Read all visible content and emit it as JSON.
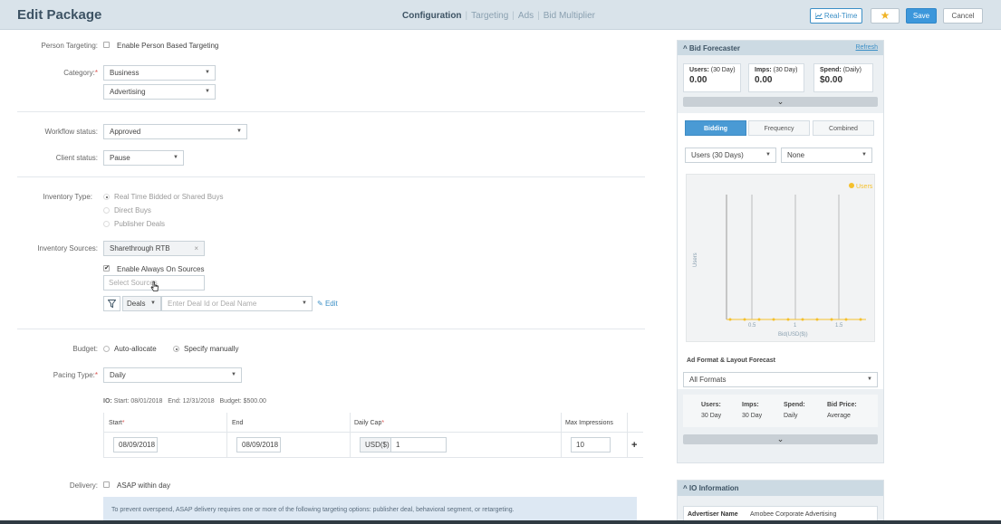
{
  "header": {
    "title": "Edit Package",
    "tabs": [
      "Configuration",
      "Targeting",
      "Ads",
      "Bid Multiplier"
    ],
    "realtime_label": "Real-Time",
    "star": "★",
    "save_label": "Save",
    "cancel_label": "Cancel"
  },
  "person_targeting": {
    "label": "Person Targeting:",
    "checkbox_label": "Enable Person Based Targeting"
  },
  "category": {
    "label": "Category:",
    "required": "*",
    "primary": "Business",
    "secondary": "Advertising"
  },
  "workflow": {
    "label": "Workflow status:",
    "value": "Approved"
  },
  "client_status": {
    "label": "Client status:",
    "value": "Pause"
  },
  "inventory_type": {
    "label": "Inventory Type:",
    "options": [
      "Real Time Bidded or Shared Buys",
      "Direct Buys",
      "Publisher Deals"
    ]
  },
  "inventory_sources": {
    "label": "Inventory Sources:",
    "tag": "Sharethrough RTB",
    "tag_remove": "×",
    "always_on_label": "Enable Always On Sources",
    "always_on_check": "✔",
    "select_placeholder": "Select Sources",
    "deals_label": "Deals",
    "deal_placeholder": "Enter Deal Id or Deal Name",
    "edit_label": "Edit",
    "edit_icon": "✎"
  },
  "budget": {
    "label": "Budget:",
    "options": [
      "Auto-allocate",
      "Specify manually"
    ]
  },
  "pacing": {
    "label": "Pacing Type:",
    "required": "*",
    "value": "Daily"
  },
  "io_summary": {
    "io": "IO:",
    "start_label": "Start:",
    "start": "08/01/2018",
    "end_label": "End:",
    "end": "12/31/2018",
    "budget_label": "Budget:",
    "budget": "$500.00"
  },
  "flight_table": {
    "headers": [
      "Start",
      "End",
      "Daily Cap",
      "Max Impressions"
    ],
    "required": "*",
    "row": {
      "start": "08/09/2018",
      "end": "08/09/2018",
      "currency": "USD($)",
      "daily_cap": "1",
      "max_impressions": "10"
    },
    "add": "+"
  },
  "delivery": {
    "label": "Delivery:",
    "checkbox_label": "ASAP within day",
    "note": "To prevent overspend, ASAP delivery requires one or more of the following targeting options: publisher deal, behavioral segment, or retargeting."
  },
  "bid_forecaster": {
    "title": "Bid Forecaster",
    "caret": "^",
    "refresh": "Refresh",
    "stats": [
      {
        "key": "Users:",
        "period": "(30 Day)",
        "value": "0.00"
      },
      {
        "key": "Imps:",
        "period": "(30 Day)",
        "value": "0.00"
      },
      {
        "key": "Spend:",
        "period": "(Daily)",
        "value": "$0.00"
      }
    ],
    "expand": "⌄",
    "tabs": [
      "Bidding",
      "Frequency",
      "Combined"
    ],
    "metric_select": "Users (30 Days)",
    "compare_select": "None",
    "chart_legend": "Users",
    "chart_ylabel": "Users",
    "chart_xlabel": "Bid(USD($))",
    "chart_ticks": [
      "0.5",
      "1",
      "1.5"
    ],
    "format_title": "Ad Format & Layout Forecast",
    "format_select": "All Formats",
    "format_cols": [
      {
        "k": "Users:",
        "sub": "30 Day"
      },
      {
        "k": "Imps:",
        "sub": "30 Day"
      },
      {
        "k": "Spend:",
        "sub": "Daily"
      },
      {
        "k": "Bid Price:",
        "sub": "Average"
      }
    ]
  },
  "io_information": {
    "title": "IO Information",
    "caret": "^",
    "advertiser_label": "Advertiser Name",
    "advertiser_value": "Amobee Corporate Advertising"
  },
  "colors": {
    "accent": "#3c97db",
    "header_bg": "#d9e3ea",
    "series": "#f5c02c"
  }
}
